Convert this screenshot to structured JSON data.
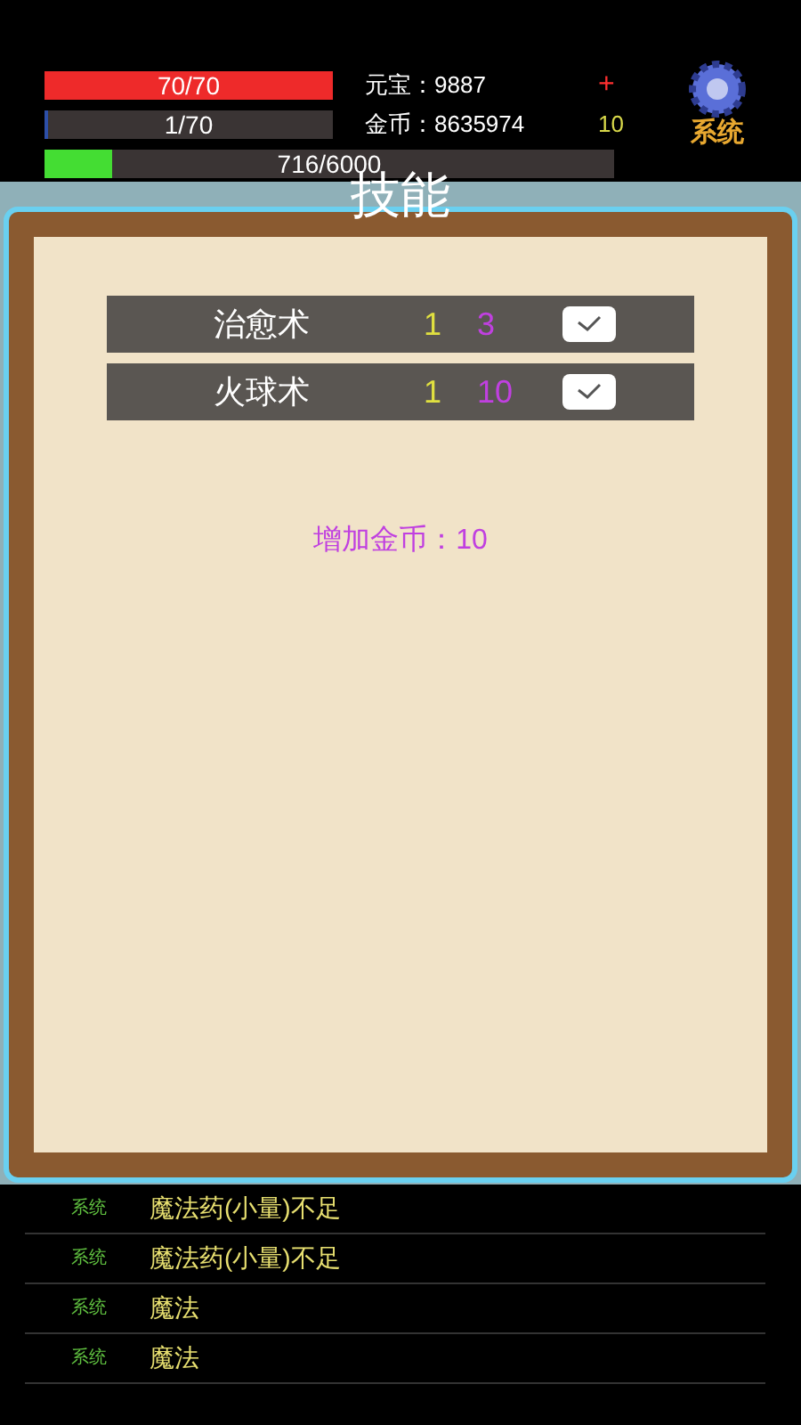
{
  "stats": {
    "hp": {
      "text": "70/70",
      "level": 1
    },
    "mp": {
      "text": "1/70",
      "level": 0.014
    },
    "exp": {
      "text": "716/6000",
      "level": 0.119
    }
  },
  "currency": [
    {
      "label": "元宝：",
      "value": "9887",
      "extra": "+",
      "kind": "add"
    },
    {
      "label": "金币：",
      "value": "8635974",
      "extra": "10",
      "kind": "count"
    }
  ],
  "system_button": {
    "label": "系统"
  },
  "title": "技能",
  "skills": [
    {
      "name": "治愈术",
      "level": "1",
      "cost": "3",
      "checked": true
    },
    {
      "name": "火球术",
      "level": "1",
      "cost": "10",
      "checked": true
    }
  ],
  "bonus": "增加金币：10",
  "log": [
    {
      "source": "系统",
      "message": "魔法药(小量)不足"
    },
    {
      "source": "系统",
      "message": "魔法药(小量)不足"
    },
    {
      "source": "系统",
      "message": "魔法"
    },
    {
      "source": "系统",
      "message": "魔法"
    }
  ]
}
